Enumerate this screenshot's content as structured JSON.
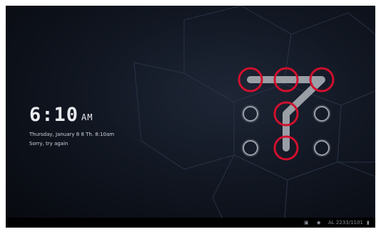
{
  "lockscreen": {
    "time": "6:10",
    "ampm": "AM",
    "date_line": "Thursday, January 8    8 Th. 8:10am",
    "status": "Sorry, try again"
  },
  "pattern": {
    "grid": "3x3",
    "selected_dots": [
      0,
      1,
      2,
      4,
      7
    ],
    "path_order": [
      0,
      1,
      2,
      4,
      7
    ],
    "selected_color": "#d0102c",
    "unselected_color": "#9ea3ab",
    "path_color": "#a9adb4"
  },
  "system_bar": {
    "icons": [
      "notification-icon",
      "wifi-icon",
      "battery-icon"
    ],
    "status_text": "AL 2233/1101"
  }
}
